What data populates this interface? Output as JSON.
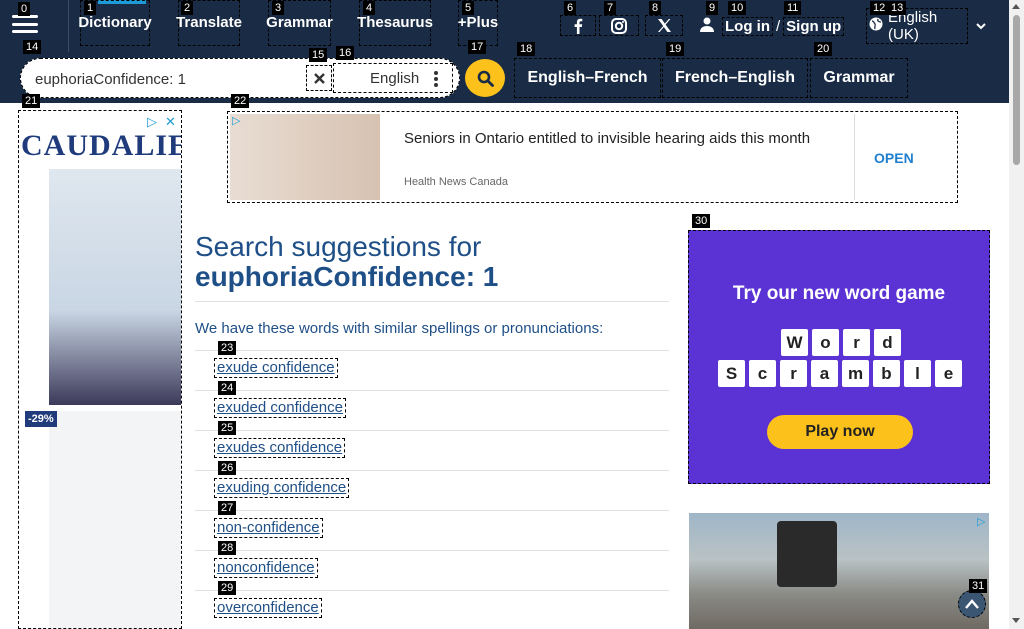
{
  "nav": {
    "menu_icon": "hamburger-icon",
    "links": [
      {
        "id": "1",
        "label": "Dictionary"
      },
      {
        "id": "2",
        "label": "Translate"
      },
      {
        "id": "3",
        "label": "Grammar"
      },
      {
        "id": "4",
        "label": "Thesaurus"
      },
      {
        "id": "5",
        "label": "+Plus"
      }
    ],
    "social_icons": [
      "facebook-icon",
      "instagram-icon",
      "x-twitter-icon"
    ],
    "login": "Log in",
    "auth_sep": "/",
    "signup": "Sign up",
    "language": "English (UK)"
  },
  "search": {
    "query": "euphoriaConfidence: 1",
    "language": "English",
    "quick_links": [
      "English–French",
      "French–English",
      "Grammar"
    ]
  },
  "badges": [
    "0",
    "1",
    "2",
    "3",
    "4",
    "5",
    "6",
    "7",
    "8",
    "9",
    "10",
    "11",
    "12",
    "13",
    "14",
    "15",
    "16",
    "17",
    "18",
    "19",
    "20",
    "21",
    "22",
    "23",
    "24",
    "25",
    "26",
    "27",
    "28",
    "29",
    "30",
    "31"
  ],
  "left_ad": {
    "brand": "CAUDALIE",
    "discount": "-29%"
  },
  "banner_ad": {
    "headline": "Seniors in Ontario entitled to invisible hearing aids this month",
    "source": "Health News Canada",
    "cta": "OPEN"
  },
  "main": {
    "title": "Search suggestions for",
    "query": "euphoriaConfidence: 1",
    "intro": "We have these words with similar spellings or pronunciations:",
    "suggestions": [
      "exude confidence",
      "exuded confidence",
      "exudes confidence",
      "exuding confidence",
      "non-confidence",
      "nonconfidence",
      "overconfidence"
    ]
  },
  "game_ad": {
    "title": "Try our new word game",
    "row1": [
      "W",
      "o",
      "r",
      "d"
    ],
    "row2": [
      "S",
      "c",
      "r",
      "a",
      "m",
      "b",
      "l",
      "e"
    ],
    "cta": "Play now"
  },
  "colors": {
    "nav_bg": "#1a2c45",
    "accent_yellow": "#fcc21b",
    "link_blue": "#1f4f87",
    "game_purple": "#5b33d4"
  }
}
